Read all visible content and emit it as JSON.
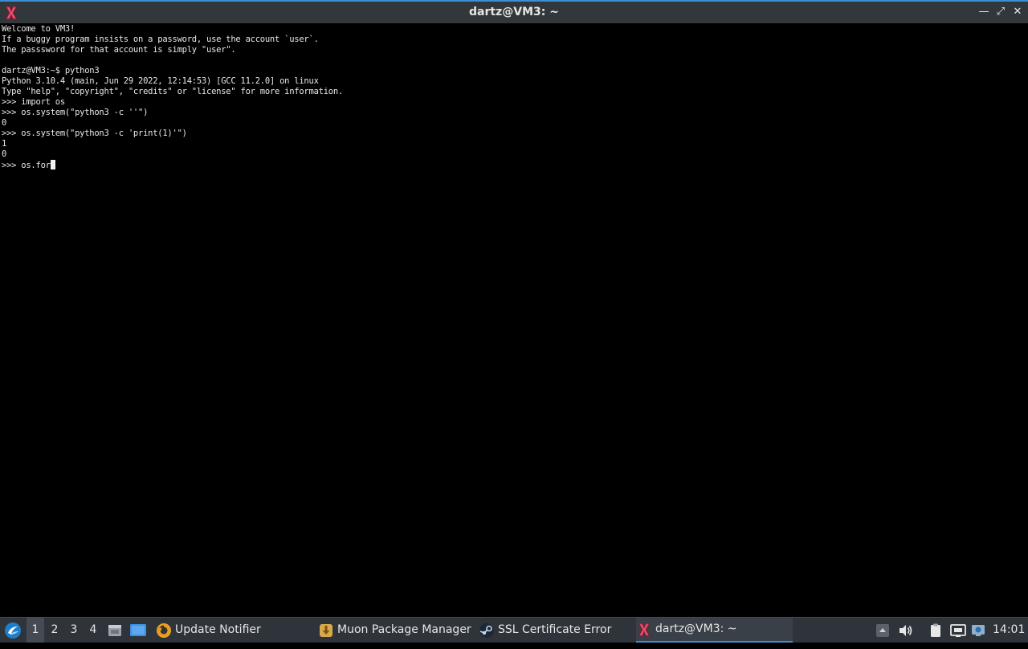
{
  "window": {
    "title": "dartz@VM3: ~",
    "minimize_label": "—",
    "maximize_label": "⤢",
    "close_label": "✕"
  },
  "terminal": {
    "lines": [
      "Welcome to VM3!",
      "If a buggy program insists on a password, use the account `user`.",
      "The passsword for that account is simply \"user\".",
      "",
      "dartz@VM3:~$ python3",
      "Python 3.10.4 (main, Jun 29 2022, 12:14:53) [GCC 11.2.0] on linux",
      "Type \"help\", \"copyright\", \"credits\" or \"license\" for more information.",
      ">>> import os",
      ">>> os.system(\"python3 -c ''\")",
      "0",
      ">>> os.system(\"python3 -c 'print(1)'\")",
      "1",
      "0"
    ],
    "current_input": ">>> os.for"
  },
  "taskbar": {
    "desktops": [
      "1",
      "2",
      "3",
      "4"
    ],
    "active_desktop": "1",
    "tasks": {
      "update": "Update Notifier",
      "muon": "Muon Package Manager",
      "ssl": "SSL Certificate Error",
      "term": "dartz@VM3: ~"
    },
    "clock": "14:01"
  },
  "colors": {
    "accent": "#3b8fd6",
    "titlebar_bg": "#32373c",
    "taskbar_bg": "#2f343a",
    "terminal_bg": "#000000",
    "terminal_fg": "#e8e8e8"
  },
  "icons": {
    "app": "xterm-x-icon",
    "start": "lubuntu-logo-icon",
    "files": "file-manager-icon",
    "desktop": "show-desktop-icon",
    "update": "update-notifier-icon",
    "muon": "muon-package-icon",
    "ssl": "steam-icon",
    "term": "xterm-x-icon",
    "tray": [
      "tray-expand-icon",
      "volume-icon",
      "clipboard-icon",
      "network-icon",
      "update-tray-icon"
    ]
  }
}
